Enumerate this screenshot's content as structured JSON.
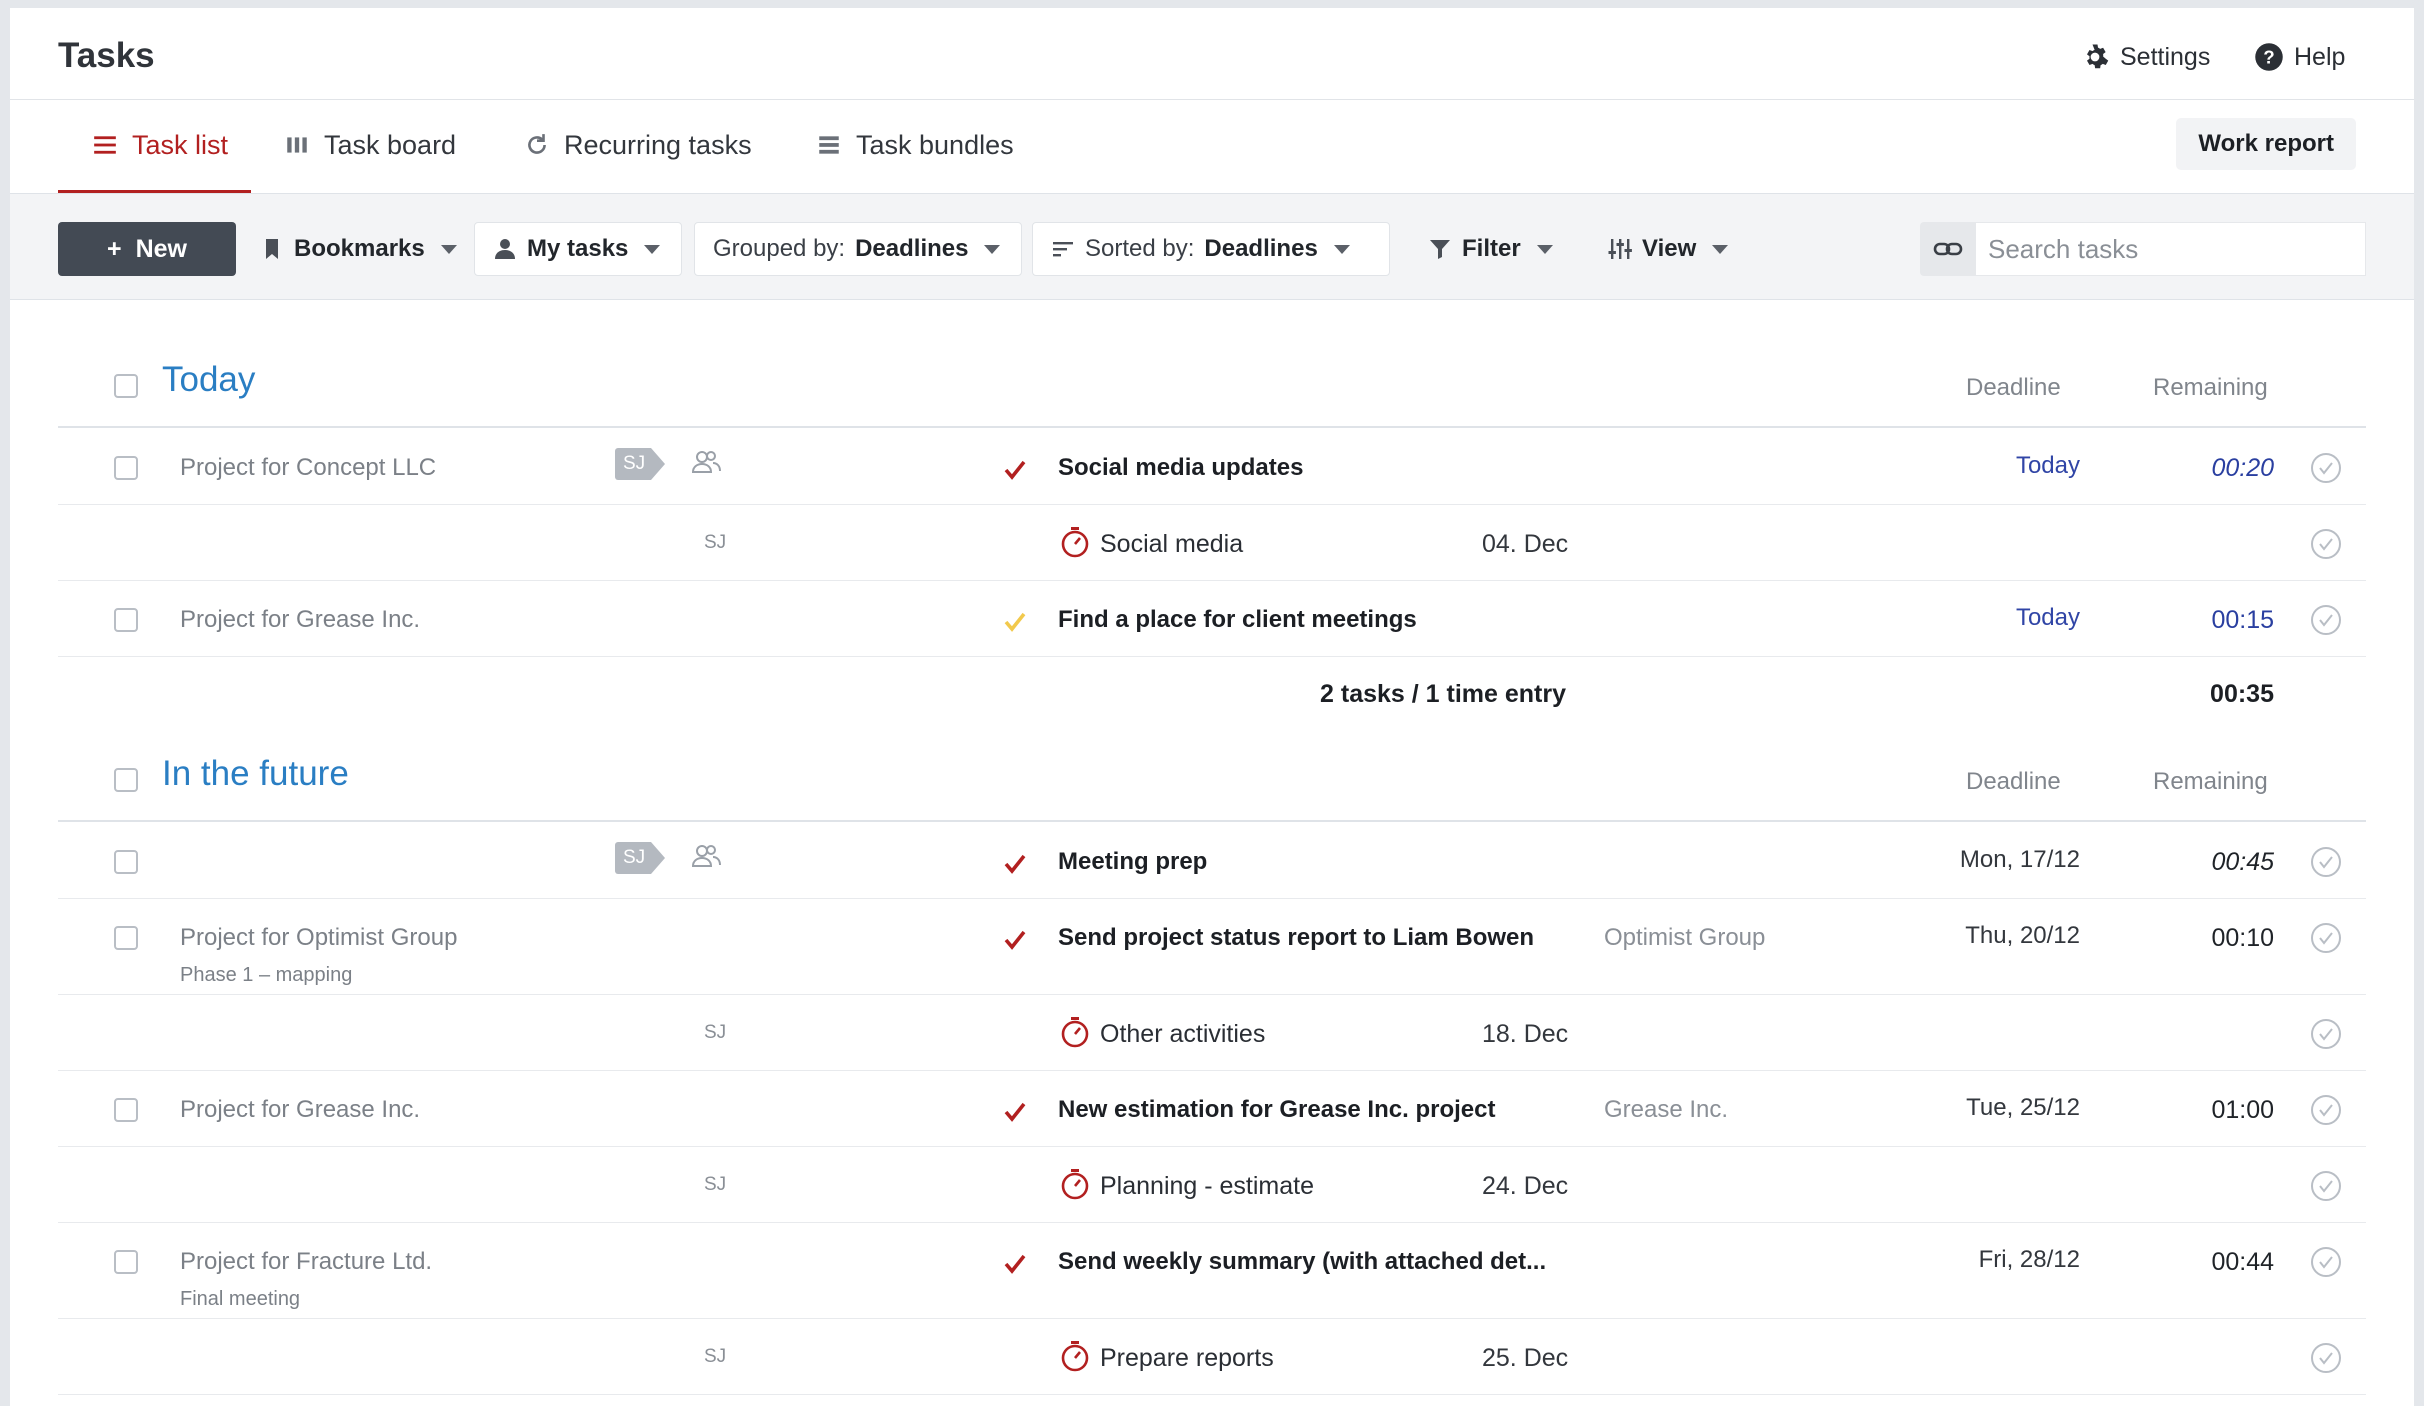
{
  "header": {
    "title": "Tasks",
    "settings_label": "Settings",
    "help_label": "Help"
  },
  "tabs": [
    {
      "label": "Task list",
      "active": true
    },
    {
      "label": "Task board",
      "active": false
    },
    {
      "label": "Recurring tasks",
      "active": false
    },
    {
      "label": "Task bundles",
      "active": false
    }
  ],
  "work_report_label": "Work report",
  "toolbar": {
    "new_label": "New",
    "bookmarks_label": "Bookmarks",
    "my_tasks_label": "My tasks",
    "grouped_prefix": "Grouped by:",
    "grouped_value": "Deadlines",
    "sorted_prefix": "Sorted by:",
    "sorted_value": "Deadlines",
    "filter_label": "Filter",
    "view_label": "View",
    "search_placeholder": "Search tasks"
  },
  "columns": {
    "deadline": "Deadline",
    "remaining": "Remaining"
  },
  "groups": [
    {
      "title": "Today",
      "rows": [
        {
          "project": "Project for Concept LLC",
          "tag": "SJ",
          "task": "Social media updates",
          "deadline": "Today",
          "remaining": "00:20"
        },
        {
          "initials": "SJ",
          "entry": "Social media",
          "date": "04. Dec"
        },
        {
          "project": "Project for Grease Inc.",
          "task": "Find a place for client meetings",
          "deadline": "Today",
          "remaining": "00:15"
        }
      ],
      "summary": {
        "label": "2 tasks / 1 time entry",
        "total": "00:35"
      }
    },
    {
      "title": "In the future",
      "rows": [
        {
          "tag": "SJ",
          "task": "Meeting prep",
          "deadline": "Mon, 17/12",
          "remaining": "00:45"
        },
        {
          "project": "Project for Optimist Group",
          "subproject": "Phase 1 – mapping",
          "task": "Send project status report to Liam Bowen",
          "client": "Optimist Group",
          "deadline": "Thu, 20/12",
          "remaining": "00:10"
        },
        {
          "initials": "SJ",
          "entry": "Other activities",
          "date": "18. Dec"
        },
        {
          "project": "Project for Grease Inc.",
          "task": "New estimation for Grease Inc. project",
          "client": "Grease Inc.",
          "deadline": "Tue, 25/12",
          "remaining": "01:00"
        },
        {
          "initials": "SJ",
          "entry": "Planning - estimate",
          "date": "24. Dec"
        },
        {
          "project": "Project for Fracture Ltd.",
          "subproject": "Final meeting",
          "task": "Send weekly summary (with attached det...",
          "deadline": "Fri, 28/12",
          "remaining": "00:44"
        },
        {
          "initials": "SJ",
          "entry": "Prepare reports",
          "date": "25. Dec"
        }
      ]
    }
  ],
  "colors": {
    "accent_red": "#b22020",
    "group_blue": "#2a7ec3",
    "today_blue": "#3045a6",
    "check_yellow": "#f2c94c"
  }
}
